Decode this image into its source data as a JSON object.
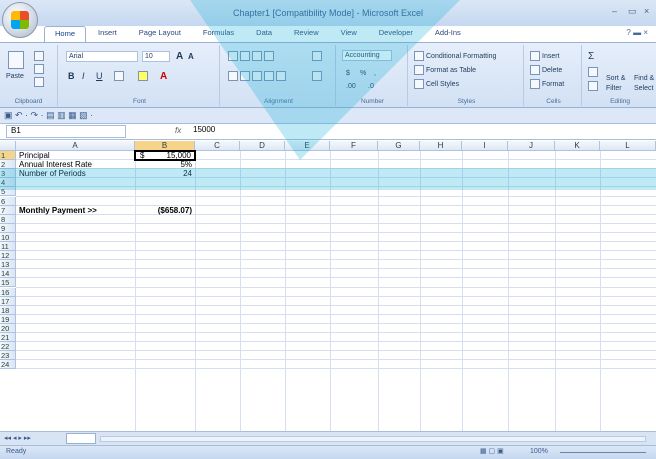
{
  "window": {
    "title": "Chapter1  [Compatibility Mode] - Microsoft Excel",
    "min": "–",
    "max": "▭",
    "close": "×"
  },
  "tabs": [
    {
      "label": "Home",
      "active": true
    },
    {
      "label": "Insert"
    },
    {
      "label": "Page Layout"
    },
    {
      "label": "Formulas"
    },
    {
      "label": "Data"
    },
    {
      "label": "Review"
    },
    {
      "label": "View"
    },
    {
      "label": "Developer"
    },
    {
      "label": "Add-Ins"
    }
  ],
  "ribbon": {
    "clipboard": {
      "label": "Clipboard",
      "paste": "Paste"
    },
    "font": {
      "label": "Font",
      "name": "Arial",
      "size": "10",
      "bold": "B",
      "italic": "I",
      "underline": "U",
      "grow": "A",
      "shrink": "A"
    },
    "alignment": {
      "label": "Alignment"
    },
    "number": {
      "label": "Number",
      "format": "Accounting",
      "currency": "$",
      "percent": "%",
      "comma": ",",
      "inc_dec": ".00",
      "dec_dec": ".0"
    },
    "styles": {
      "label": "Styles",
      "conditional": "Conditional Formatting",
      "format_table": "Format as Table",
      "cell_styles": "Cell Styles"
    },
    "cells": {
      "label": "Cells",
      "insert": "Insert",
      "delete": "Delete",
      "format": "Format"
    },
    "editing": {
      "label": "Editing",
      "sum": "Σ",
      "sort": "Sort &",
      "filter": "Filter",
      "find": "Find &",
      "select": "Select"
    }
  },
  "formula_bar": {
    "name_box": "B1",
    "fx": "fx",
    "value": "15000"
  },
  "columns": [
    "A",
    "B",
    "C",
    "D",
    "E",
    "F",
    "G",
    "H",
    "I",
    "J",
    "K",
    "L"
  ],
  "rows": [
    "1",
    "2",
    "3",
    "4",
    "5",
    "6",
    "7",
    "8",
    "9",
    "10",
    "11",
    "12",
    "13",
    "14",
    "15",
    "16",
    "17",
    "18",
    "19",
    "20",
    "21",
    "22",
    "23",
    "24"
  ],
  "cells": {
    "a1": "Principal",
    "b1_sym": "$",
    "b1_val": "15,000",
    "a2": "Annual Interest Rate",
    "b2": "5%",
    "a3": "Number of Periods",
    "b3": "24",
    "a7": "Monthly Payment >>",
    "b7": "($658.07)"
  },
  "status": {
    "ready": "Ready",
    "zoom": "100%"
  },
  "colors": {
    "accent": "#1ab0d8",
    "select": "#f8d48a"
  }
}
